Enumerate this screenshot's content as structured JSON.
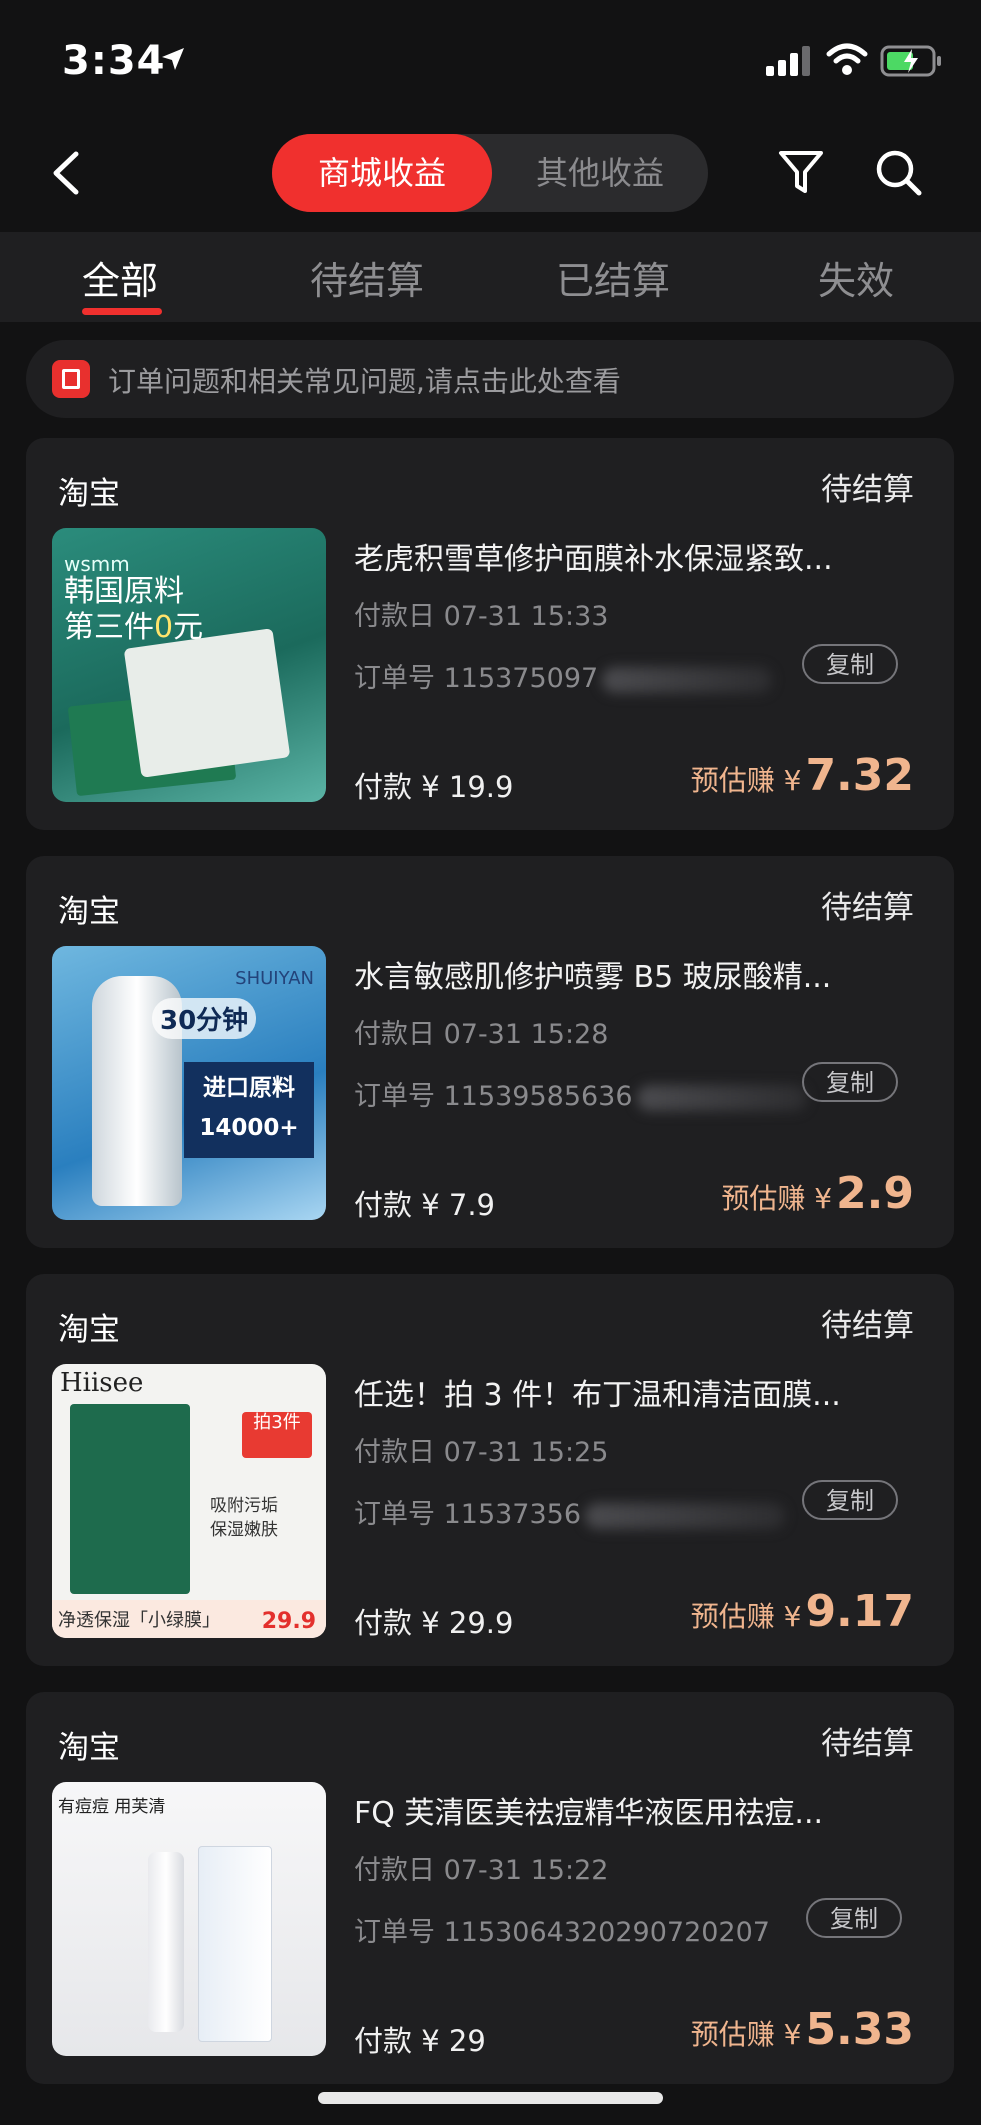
{
  "status_bar": {
    "time": "3:34"
  },
  "nav": {
    "seg_active": "商城收益",
    "seg_inactive": "其他收益"
  },
  "tabs": [
    {
      "label": "全部"
    },
    {
      "label": "待结算"
    },
    {
      "label": "已结算"
    },
    {
      "label": "失效"
    }
  ],
  "notice": {
    "text": "订单问题和相关常见问题,请点击此处查看"
  },
  "common": {
    "copy_label": "复制",
    "earn_label": "预估赚 ¥"
  },
  "orders": [
    {
      "shop": "淘宝",
      "status": "待结算",
      "title": "老虎积雪草修护面膜补水保湿紧致...",
      "pay_date": "付款日 07-31 15:33",
      "order_no": "订单号 115375097",
      "pay": "付款 ¥ 19.9",
      "earn": "7.32"
    },
    {
      "shop": "淘宝",
      "status": "待结算",
      "title": "水言敏感肌修护喷雾 B5 玻尿酸精...",
      "pay_date": "付款日 07-31 15:28",
      "order_no": "订单号 11539585636",
      "pay": "付款 ¥ 7.9",
      "earn": "2.9"
    },
    {
      "shop": "淘宝",
      "status": "待结算",
      "title": "任选！拍 3 件！布丁温和清洁面膜...",
      "pay_date": "付款日 07-31 15:25",
      "order_no": "订单号 11537356",
      "pay": "付款 ¥ 29.9",
      "earn": "9.17"
    },
    {
      "shop": "淘宝",
      "status": "待结算",
      "title": "FQ 芙清医美祛痘精华液医用祛痘...",
      "pay_date": "付款日 07-31 15:22",
      "order_no": "订单号 1153064320290720207",
      "pay": "付款 ¥ 29",
      "earn": "5.33"
    }
  ],
  "thumbs": {
    "t1": {
      "tag": "wsmm",
      "line1": "韩国原料",
      "line2a": "第三件",
      "line2b": "0",
      "line2c": "元"
    },
    "t2": {
      "brand": "SHUIYAN",
      "badge": "30分钟",
      "box1": "进口原料",
      "box2": "14000+"
    },
    "t3": {
      "brand": "Hiisee",
      "red": "拍3件",
      "mid1": "吸附污垢",
      "mid2": "保湿嫩肤",
      "band1": "净透保湿「小绿膜」",
      "band2": "29.9"
    },
    "t4": {
      "header": "有痘痘 用芙清"
    }
  }
}
